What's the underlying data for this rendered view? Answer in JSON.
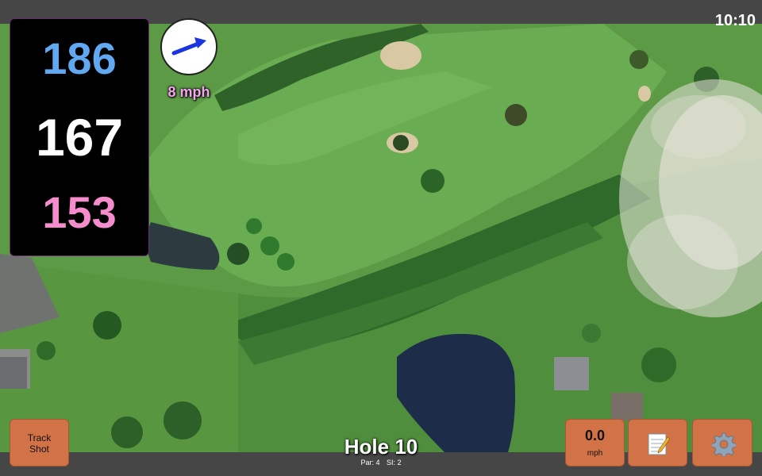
{
  "status_bar": {
    "time": "10:10"
  },
  "distances": {
    "back": "186",
    "middle": "167",
    "front": "153",
    "colors": {
      "back": "#62a8f0",
      "middle": "#ffffff",
      "front": "#f58ccc"
    }
  },
  "wind": {
    "speed_label": "8 mph",
    "arrow_color": "#1a35e0",
    "label_color": "#f6a6f0",
    "icon": "wind-arrow-icon"
  },
  "buttons": {
    "track_shot_line1": "Track",
    "track_shot_line2": "Shot",
    "speed_value": "0.0",
    "speed_unit": "mph",
    "notes_icon": "notepad-icon",
    "settings_icon": "gear-icon",
    "accent_color": "#d27347"
  },
  "hole": {
    "title": "Hole 10",
    "par": "Par: 4",
    "stroke_index": "SI: 2"
  }
}
